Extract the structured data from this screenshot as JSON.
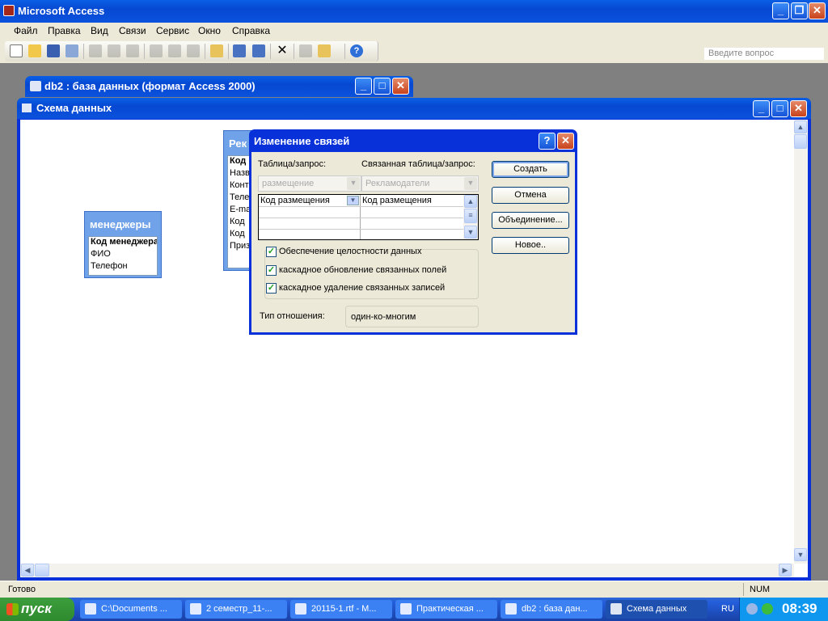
{
  "app": {
    "title": "Microsoft Access"
  },
  "menu": [
    "Файл",
    "Правка",
    "Вид",
    "Связи",
    "Сервис",
    "Окно",
    "Справка"
  ],
  "help_placeholder": "Введите вопрос",
  "db_window": {
    "title": "db2 : база данных (формат Access 2000)"
  },
  "schema_window": {
    "title": "Схема данных"
  },
  "tables": {
    "managers": {
      "title": "менеджеры",
      "fields": [
        "Код менеджера",
        "ФИО",
        "Телефон"
      ]
    },
    "advertisers": {
      "title": "Рек",
      "fields": [
        "Код",
        "Назв",
        "Конт",
        "Теле",
        "E-ma",
        "Код",
        "Код",
        "Приз"
      ]
    }
  },
  "dialog": {
    "title": "Изменение связей",
    "table_label": "Таблица/запрос:",
    "related_label": "Связанная таблица/запрос:",
    "table_value": "размещение",
    "related_value": "Рекламодатели",
    "grid": [
      [
        "Код размещения",
        "Код размещения"
      ],
      [
        "",
        ""
      ],
      [
        "",
        ""
      ],
      [
        "",
        ""
      ]
    ],
    "checkboxes": [
      {
        "label": "Обеспечение целостности данных",
        "checked": true
      },
      {
        "label": "каскадное обновление связанных полей",
        "checked": true
      },
      {
        "label": "каскадное удаление связанных записей",
        "checked": true
      }
    ],
    "relation_label": "Тип отношения:",
    "relation_value": "один-ко-многим",
    "buttons": {
      "create": "Создать",
      "cancel": "Отмена",
      "join": "Объединение...",
      "new": "Новое.."
    }
  },
  "status": {
    "left": "Готово",
    "right": "NUM"
  },
  "taskbar": {
    "start": "пуск",
    "tasks": [
      "C:\\Documents ...",
      "2 семестр_11-...",
      "20115-1.rtf - M...",
      "Практическая ...",
      "db2 : база дан...",
      "Схема данных"
    ],
    "lang": "RU",
    "clock": "08:39"
  },
  "colors": {
    "titlebar": "#0a5fe5",
    "mdi_bg": "#808080",
    "dialog_bg": "#ece9d8"
  }
}
